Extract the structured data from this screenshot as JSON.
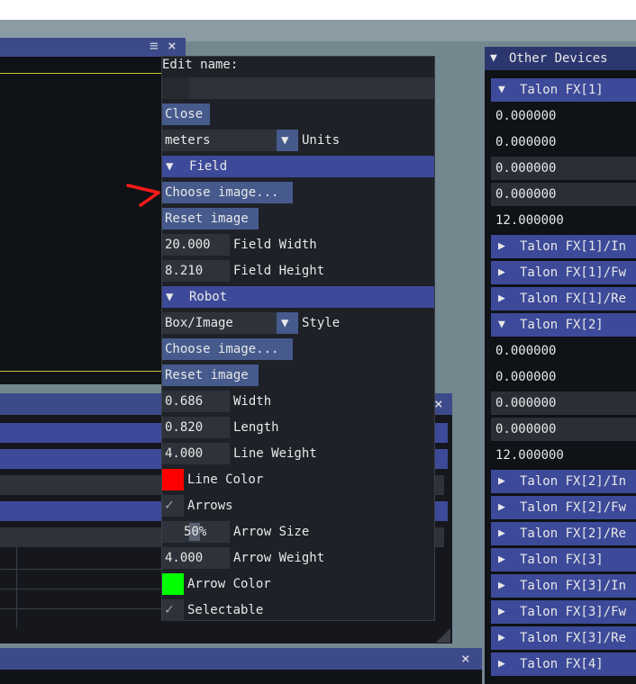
{
  "popup": {
    "edit_name_label": "Edit name:",
    "edit_name_value": "",
    "close_label": "Close",
    "units_value": "meters",
    "units_label": "Units",
    "field_header": "Field",
    "field_choose_image": "Choose image...",
    "field_reset_image": "Reset image",
    "field_width_value": "20.000",
    "field_width_label": "Field Width",
    "field_height_value": "8.210",
    "field_height_label": "Field Height",
    "robot_header": "Robot",
    "style_value": "Box/Image",
    "style_label": "Style",
    "robot_choose_image": "Choose image...",
    "robot_reset_image": "Reset image",
    "width_value": "0.686",
    "width_label": "Width",
    "length_value": "0.820",
    "length_label": "Length",
    "line_weight_value": "4.000",
    "line_weight_label": "Line Weight",
    "line_color_label": "Line Color",
    "line_color": "#ff0000",
    "arrows_label": "Arrows",
    "arrows_checked": true,
    "arrow_size_value": "50%",
    "arrow_size_label": "Arrow Size",
    "arrow_weight_value": "4.000",
    "arrow_weight_label": "Arrow Weight",
    "arrow_color_label": "Arrow Color",
    "arrow_color": "#00ff00",
    "selectable_label": "Selectable",
    "selectable_checked": true
  },
  "other_devices": {
    "title": "Other Devices",
    "rows": [
      {
        "kind": "header",
        "arrow": "▼",
        "label": "Talon FX[1]"
      },
      {
        "kind": "value",
        "label": "0.000000"
      },
      {
        "kind": "value",
        "label": "0.000000"
      },
      {
        "kind": "input",
        "label": "0.000000"
      },
      {
        "kind": "input",
        "label": "0.000000"
      },
      {
        "kind": "value",
        "label": "12.000000"
      },
      {
        "kind": "header",
        "arrow": "▶",
        "label": "Talon FX[1]/In"
      },
      {
        "kind": "header",
        "arrow": "▶",
        "label": "Talon FX[1]/Fw"
      },
      {
        "kind": "header",
        "arrow": "▶",
        "label": "Talon FX[1]/Re"
      },
      {
        "kind": "header",
        "arrow": "▼",
        "label": "Talon FX[2]"
      },
      {
        "kind": "value",
        "label": "0.000000"
      },
      {
        "kind": "value",
        "label": "0.000000"
      },
      {
        "kind": "input",
        "label": "0.000000"
      },
      {
        "kind": "input",
        "label": "0.000000"
      },
      {
        "kind": "value",
        "label": "12.000000"
      },
      {
        "kind": "header",
        "arrow": "▶",
        "label": "Talon FX[2]/In"
      },
      {
        "kind": "header",
        "arrow": "▶",
        "label": "Talon FX[2]/Fw"
      },
      {
        "kind": "header",
        "arrow": "▶",
        "label": "Talon FX[2]/Re"
      },
      {
        "kind": "header",
        "arrow": "▶",
        "label": "Talon FX[3]"
      },
      {
        "kind": "header",
        "arrow": "▶",
        "label": "Talon FX[3]/In"
      },
      {
        "kind": "header",
        "arrow": "▶",
        "label": "Talon FX[3]/Fw"
      },
      {
        "kind": "header",
        "arrow": "▶",
        "label": "Talon FX[3]/Re"
      },
      {
        "kind": "header",
        "arrow": "▶",
        "label": "Talon FX[4]"
      }
    ]
  },
  "icons": {
    "menu": "≡",
    "close": "×",
    "expanded": "▼",
    "collapsed": "▶",
    "check": "✓"
  },
  "colors": {
    "header": "#3d4a99",
    "button": "#465a8c",
    "annotation_arrow": "#ff1a1a"
  }
}
